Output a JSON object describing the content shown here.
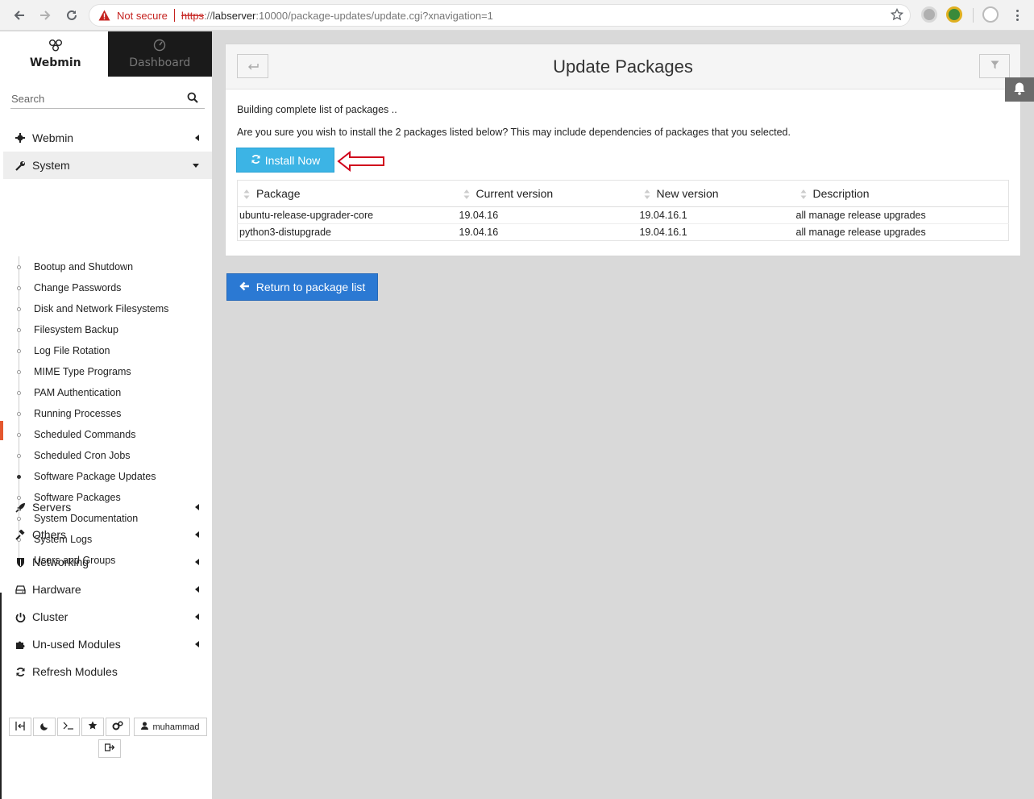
{
  "browser": {
    "security_label": "Not secure",
    "url_scheme": "https",
    "url_separator": "://",
    "url_host": "labserver",
    "url_rest": ":10000/package-updates/update.cgi?xnavigation=1"
  },
  "sidebar": {
    "tab_webmin": "Webmin",
    "tab_dashboard": "Dashboard",
    "search_placeholder": "Search",
    "menu_top": [
      {
        "label": "Webmin",
        "icon": "gear-icon"
      },
      {
        "label": "System",
        "icon": "wrench-icon"
      }
    ],
    "system_items": [
      "Bootup and Shutdown",
      "Change Passwords",
      "Disk and Network Filesystems",
      "Filesystem Backup",
      "Log File Rotation",
      "MIME Type Programs",
      "PAM Authentication",
      "Running Processes",
      "Scheduled Commands",
      "Scheduled Cron Jobs",
      "Software Package Updates",
      "Software Packages",
      "System Documentation",
      "System Logs",
      "Users and Groups"
    ],
    "active_item": "Software Package Updates",
    "menu_bottom": [
      {
        "label": "Servers",
        "icon": "rocket-icon"
      },
      {
        "label": "Others",
        "icon": "gavel-icon"
      },
      {
        "label": "Networking",
        "icon": "shield-icon"
      },
      {
        "label": "Hardware",
        "icon": "hdd-icon"
      },
      {
        "label": "Cluster",
        "icon": "power-icon"
      },
      {
        "label": "Un-used Modules",
        "icon": "puzzle-icon"
      },
      {
        "label": "Refresh Modules",
        "icon": "refresh-icon"
      }
    ],
    "user": "muhammad"
  },
  "main": {
    "title": "Update Packages",
    "building_text": "Building complete list of packages ..",
    "confirm_text": "Are you sure you wish to install the 2 packages listed below? This may include dependencies of packages that you selected.",
    "install_label": "Install Now",
    "table": {
      "headers": [
        "Package",
        "Current version",
        "New version",
        "Description"
      ],
      "rows": [
        [
          "ubuntu-release-upgrader-core",
          "19.04.16",
          "19.04.16.1",
          "all manage release upgrades"
        ],
        [
          "python3-distupgrade",
          "19.04.16",
          "19.04.16.1",
          "all manage release upgrades"
        ]
      ]
    },
    "return_label": "Return to package list"
  },
  "colors": {
    "install_button": "#3cb4e5",
    "return_button": "#2b79d3",
    "active_marker": "#e4572e",
    "annotation_arrow": "#d0021b"
  }
}
